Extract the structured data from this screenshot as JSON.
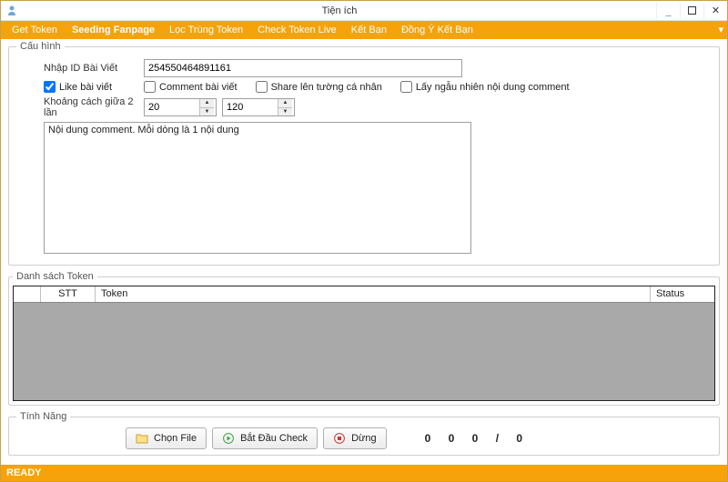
{
  "window": {
    "title": "Tiện ích",
    "minimize": "_",
    "maximize": "☐",
    "close": "✕"
  },
  "tabs": {
    "get_token": "Get Token",
    "seeding_fanpage": "Seeding Fanpage",
    "loc_trung_token": "Lọc Trùng Token",
    "check_token_live": "Check Token Live",
    "ket_ban": "Kết Bạn",
    "dong_y_ket_ban": "Đồng Ý Kết Bạn",
    "chev": "▾"
  },
  "cauhinh": {
    "legend": "Cấu hình",
    "nhap_id_label": "Nhập ID Bài Viết",
    "nhap_id_value": "254550464891161",
    "like_label": "Like bài viết",
    "like_checked": true,
    "comment_label": "Comment bài viết",
    "share_label": "Share lên tường cá nhân",
    "random_label": "Lấy ngẫu nhiên nội dung comment",
    "khoang_cach_label": "Khoảng cách giữa 2 lần",
    "spin1": "20",
    "spin2": "120",
    "comment_text": "Nội dung comment. Mỗi dòng là 1 nội dung"
  },
  "tokenlist": {
    "legend": "Danh sách Token",
    "col_stt": "STT",
    "col_token": "Token",
    "col_status": "Status"
  },
  "tinhnang": {
    "legend": "Tính Năng",
    "chon_file": "Chọn File",
    "bat_dau": "Bắt Đầu Check",
    "dung": "Dừng",
    "c1": "0",
    "c2": "0",
    "c3": "0",
    "sep": "/",
    "c4": "0"
  },
  "status": {
    "ready": "READY"
  },
  "colors": {
    "accent": "#f6a20a"
  }
}
